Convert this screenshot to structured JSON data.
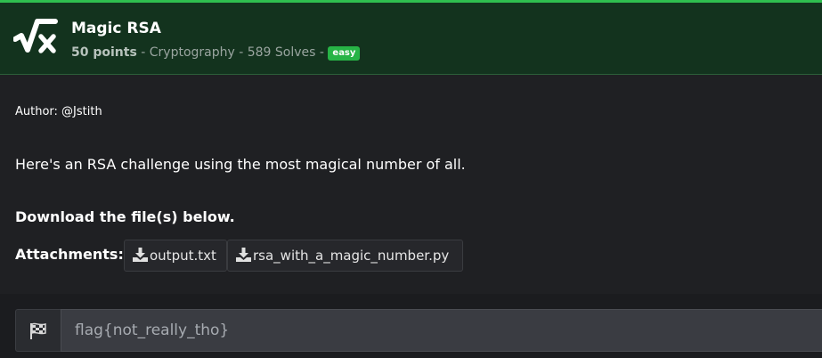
{
  "challenge": {
    "title": "Magic RSA",
    "points": "50 points",
    "sep1": " - ",
    "category": "Cryptography",
    "sep2": " - ",
    "solves": "589 Solves",
    "sep3": " - ",
    "difficulty": "easy",
    "logo_icon": "sqrt-x-icon"
  },
  "body": {
    "author": "Author: @Jstith",
    "description": "Here's an RSA challenge using the most magical number of all.",
    "download_heading": "Download the file(s) below.",
    "attachments_label": "Attachments:",
    "attachments": [
      {
        "name": "output.txt",
        "icon": "download-icon"
      },
      {
        "name": "rsa_with_a_magic_number.py",
        "icon": "download-icon"
      }
    ]
  },
  "flag": {
    "icon": "checkered-flag-icon",
    "placeholder": "flag{not_really_tho}",
    "value": ""
  },
  "colors": {
    "header_bg": "#13331e",
    "accent_green": "#2fbf4f",
    "badge_green": "#27b446",
    "page_bg": "#1f2023"
  }
}
